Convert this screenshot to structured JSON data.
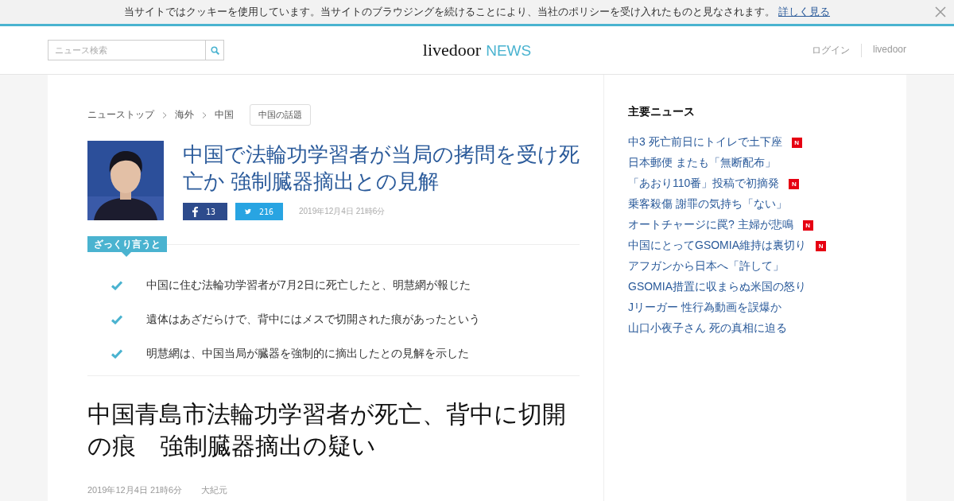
{
  "cookie_bar": {
    "message": "当サイトではクッキーを使用しています。当サイトのブラウジングを続けることにより、当社のポリシーを受け入れたものと見なされます。",
    "link": "詳しく見る"
  },
  "header": {
    "search_placeholder": "ニュース検索",
    "logo": {
      "brand": "livedoor",
      "section": "NEWS"
    },
    "links": [
      "ログイン",
      "livedoor"
    ]
  },
  "breadcrumbs": [
    "ニューストップ",
    "海外",
    "中国"
  ],
  "topic_tag": "中国の話題",
  "headline": {
    "title": "中国で法輪功学習者が当局の拷問を受け死亡か 強制臓器摘出との見解",
    "facebook_count": "13",
    "twitter_count": "216",
    "date": "2019年12月4日 21時6分"
  },
  "summary": {
    "label": "ざっくり言うと",
    "points": [
      "中国に住む法輪功学習者が7月2日に死亡したと、明慧網が報じた",
      "遺体はあざだらけで、背中にはメスで切開された痕があったという",
      "明慧網は、中国当局が臓器を強制的に摘出したとの見解を示した"
    ]
  },
  "article": {
    "title": "中国青島市法輪功学習者が死亡、背中に切開の痕　強制臓器摘出の疑い",
    "date": "2019年12月4日 21時6分",
    "source": "大紀元"
  },
  "sidebar": {
    "title": "主要ニュース",
    "items": [
      {
        "text": "中3 死亡前日にトイレで土下座",
        "badge": "N"
      },
      {
        "text": "日本郵便 またも「無断配布」"
      },
      {
        "text": "「あおり110番」投稿で初摘発",
        "badge": "N"
      },
      {
        "text": "乗客殺傷 謝罪の気持ち「ない」"
      },
      {
        "text": "オートチャージに罠? 主婦が悲鳴",
        "badge": "N"
      },
      {
        "text": "中国にとってGSOMIA維持は裏切り",
        "badge": "N"
      },
      {
        "text": "アフガンから日本へ「許して」"
      },
      {
        "text": "GSOMIA措置に収まらぬ米国の怒り"
      },
      {
        "text": "Jリーガー 性行為動画を誤爆か"
      },
      {
        "text": "山口小夜子さん 死の真相に迫る"
      }
    ]
  }
}
